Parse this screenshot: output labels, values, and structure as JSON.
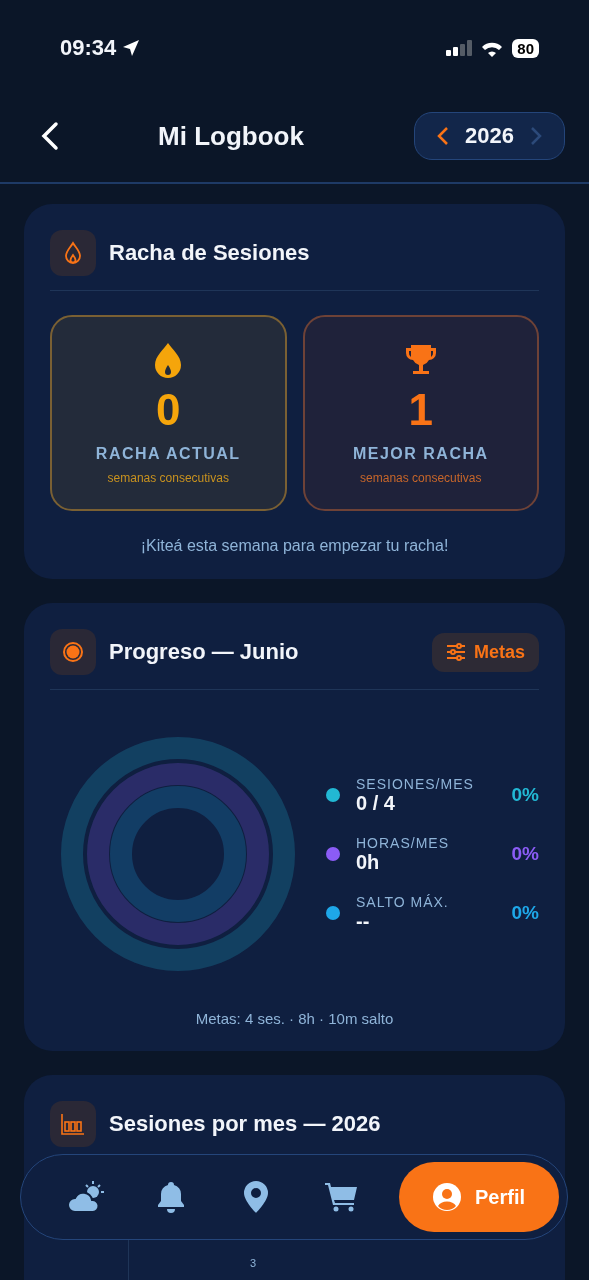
{
  "status_bar": {
    "time": "09:34",
    "battery": "80"
  },
  "header": {
    "title": "Mi Logbook",
    "year": "2026"
  },
  "streak": {
    "title": "Racha de Sesiones",
    "cards": [
      {
        "kind": "current",
        "value": "0",
        "label": "RACHA ACTUAL",
        "sublabel": "semanas consecutivas"
      },
      {
        "kind": "best",
        "value": "1",
        "label": "MEJOR RACHA",
        "sublabel": "semanas consecutivas"
      }
    ],
    "message": "¡Kiteá esta semana para empezar tu racha!"
  },
  "progress": {
    "title": "Progreso — Junio",
    "goals_button": "Metas",
    "metrics": [
      {
        "label": "SESIONES/MES",
        "value": "0 / 4",
        "percent": "0%",
        "color": "#22b8d4"
      },
      {
        "label": "HORAS/MES",
        "value": "0h",
        "percent": "0%",
        "color": "#8b5cf6"
      },
      {
        "label": "SALTO MÁX.",
        "value": "--",
        "percent": "0%",
        "color": "#1ea7e8"
      }
    ],
    "footer": "Metas: 4 ses. · 8h · 10m salto"
  },
  "sessions": {
    "title": "Sesiones por mes — 2026",
    "bar_label": "3"
  },
  "bottom_nav": [
    {
      "kind": "weather",
      "selected": false
    },
    {
      "kind": "bell",
      "selected": false
    },
    {
      "kind": "pin",
      "selected": false
    },
    {
      "kind": "cart",
      "selected": false
    },
    {
      "kind": "profile",
      "label": "Perfil",
      "selected": true
    }
  ]
}
